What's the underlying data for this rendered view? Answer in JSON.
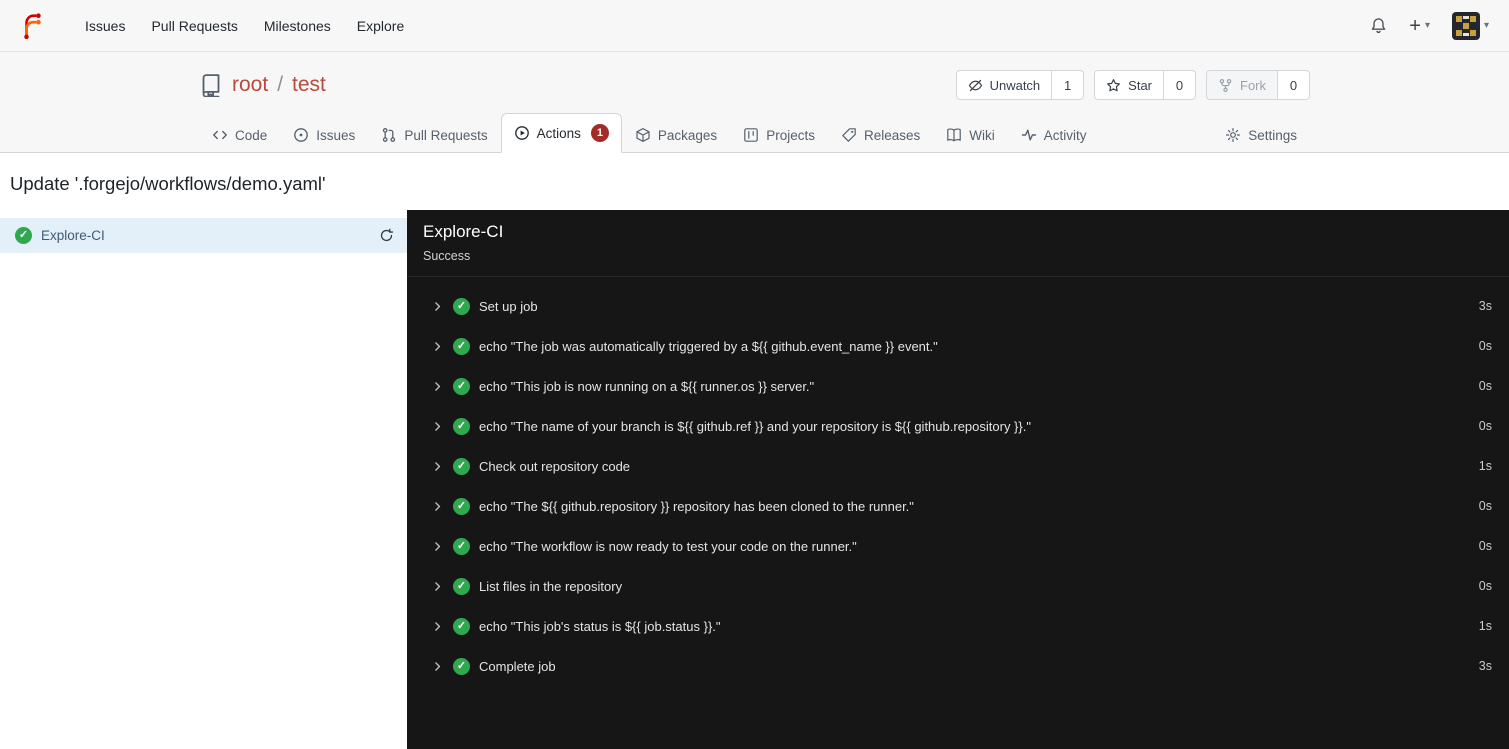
{
  "colors": {
    "logo_orange": "#ff6600",
    "logo_red": "#d40000",
    "repo_link_red": "#b94a3c",
    "success_green": "#2fa84f",
    "actions_badge_red": "#a22c28",
    "selected_job_bg": "#e3eff9",
    "log_panel_bg": "#161616"
  },
  "icons": {
    "plus": "+",
    "caret": "▾",
    "check": "✓"
  },
  "navbar": {
    "items": [
      "Issues",
      "Pull Requests",
      "Milestones",
      "Explore"
    ]
  },
  "repo": {
    "owner": "root",
    "separator": "/",
    "name": "test",
    "buttons": {
      "unwatch": {
        "label": "Unwatch",
        "count": "1"
      },
      "star": {
        "label": "Star",
        "count": "0"
      },
      "fork": {
        "label": "Fork",
        "count": "0"
      }
    },
    "tabs": [
      "Code",
      "Issues",
      "Pull Requests",
      "Actions",
      "Packages",
      "Projects",
      "Releases",
      "Wiki",
      "Activity",
      "Settings"
    ],
    "actions_badge": "1"
  },
  "run": {
    "title": "Update '.forgejo/workflows/demo.yaml'",
    "job_name": "Explore-CI",
    "status": "Success"
  },
  "steps": [
    {
      "name": "Set up job",
      "duration": "3s"
    },
    {
      "name": "echo \"The job was automatically triggered by a ${{ github.event_name }} event.\"",
      "duration": "0s"
    },
    {
      "name": "echo \"This job is now running on a ${{ runner.os }} server.\"",
      "duration": "0s"
    },
    {
      "name": "echo \"The name of your branch is ${{ github.ref }} and your repository is ${{ github.repository }}.\"",
      "duration": "0s"
    },
    {
      "name": "Check out repository code",
      "duration": "1s"
    },
    {
      "name": "echo \"The ${{ github.repository }} repository has been cloned to the runner.\"",
      "duration": "0s"
    },
    {
      "name": "echo \"The workflow is now ready to test your code on the runner.\"",
      "duration": "0s"
    },
    {
      "name": "List files in the repository",
      "duration": "0s"
    },
    {
      "name": "echo \"This job's status is ${{ job.status }}.\"",
      "duration": "1s"
    },
    {
      "name": "Complete job",
      "duration": "3s"
    }
  ]
}
